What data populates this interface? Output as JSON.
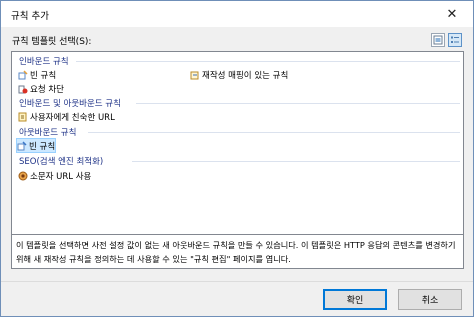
{
  "window": {
    "title": "규칙 추가",
    "close_glyph": "✕"
  },
  "template_label": "규칙 템플릿 선택(S):",
  "groups": [
    {
      "header": "인바운드 규칙",
      "items": [
        {
          "label": "빈 규칙",
          "icon": "blank-rule-icon"
        },
        {
          "label": "재작성 매핑이 있는 규칙",
          "icon": "rewrite-map-icon"
        },
        {
          "label": "요청 차단",
          "icon": "block-request-icon"
        }
      ]
    },
    {
      "header": "인바운드 및 아웃바운드 규칙",
      "items": [
        {
          "label": "사용자에게 친숙한 URL",
          "icon": "friendly-url-icon"
        }
      ]
    },
    {
      "header": "아웃바운드 규칙",
      "items": [
        {
          "label": "빈 규칙",
          "icon": "blank-rule-icon",
          "selected": true
        }
      ]
    },
    {
      "header": "SEO(검색 엔진 최적화)",
      "items": [
        {
          "label": "소문자 URL 사용",
          "icon": "lowercase-url-icon"
        }
      ]
    }
  ],
  "description": "이 템플릿을 선택하면 사전 설정 값이 없는 새 아웃바운드 규칙을 만들 수 있습니다. 이 템플릿은 HTTP 응답의 콘텐츠를 변경하기 위해 새 재작성 규칙을 정의하는 데 사용할 수 있는 \"규칙 편집\" 페이지를 엽니다.",
  "buttons": {
    "ok": "확인",
    "cancel": "취소"
  },
  "colors": {
    "accent": "#0078d7",
    "group_header": "#1e3287",
    "selection": "#cce8ff"
  }
}
